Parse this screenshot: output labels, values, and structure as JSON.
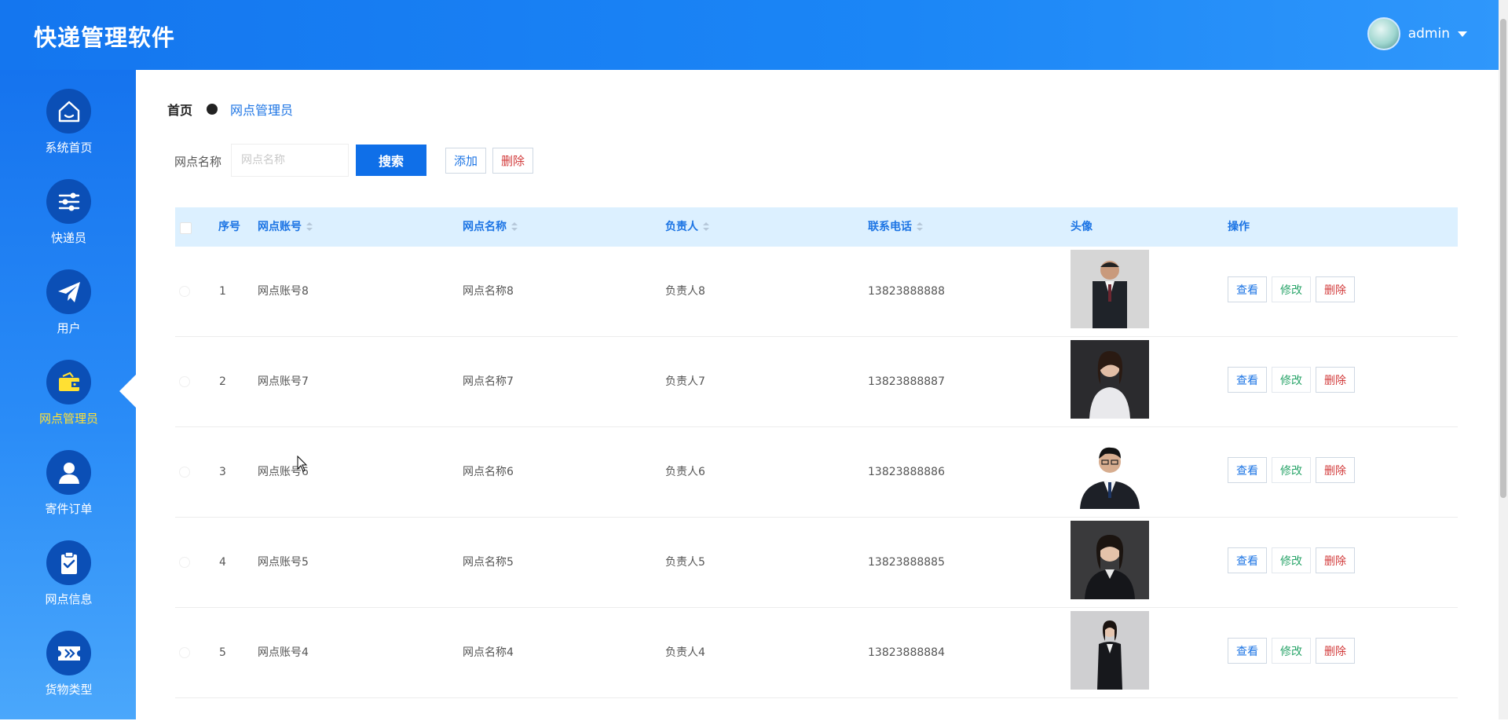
{
  "app": {
    "title": "快递管理软件"
  },
  "user": {
    "name": "admin"
  },
  "sidebar": {
    "items": [
      {
        "label": "系统首页",
        "icon": "home-icon"
      },
      {
        "label": "快递员",
        "icon": "sliders-icon"
      },
      {
        "label": "用户",
        "icon": "paper-plane-icon"
      },
      {
        "label": "网点管理员",
        "icon": "wallet-icon",
        "active": true
      },
      {
        "label": "寄件订单",
        "icon": "user-icon"
      },
      {
        "label": "网点信息",
        "icon": "clipboard-check-icon"
      },
      {
        "label": "货物类型",
        "icon": "ticket-icon"
      }
    ]
  },
  "breadcrumb": {
    "home": "首页",
    "current": "网点管理员"
  },
  "filter": {
    "label": "网点名称",
    "placeholder": "网点名称",
    "value": "",
    "search_label": "搜索",
    "add_label": "添加",
    "delete_label": "删除"
  },
  "table": {
    "headers": {
      "index": "序号",
      "account": "网点账号",
      "name": "网点名称",
      "manager": "负责人",
      "phone": "联系电话",
      "avatar": "头像",
      "actions": "操作"
    },
    "actions": {
      "view": "查看",
      "edit": "修改",
      "delete": "删除"
    },
    "rows": [
      {
        "index": "1",
        "account": "网点账号8",
        "name": "网点名称8",
        "manager": "负责人8",
        "phone": "13823888888",
        "photo": "man-suit-full"
      },
      {
        "index": "2",
        "account": "网点账号7",
        "name": "网点名称7",
        "manager": "负责人7",
        "phone": "13823888887",
        "photo": "woman-white-shirt"
      },
      {
        "index": "3",
        "account": "网点账号6",
        "name": "网点名称6",
        "manager": "负责人6",
        "phone": "13823888886",
        "photo": "man-suit-glasses"
      },
      {
        "index": "4",
        "account": "网点账号5",
        "name": "网点名称5",
        "manager": "负责人5",
        "phone": "13823888885",
        "photo": "woman-black-suit"
      },
      {
        "index": "5",
        "account": "网点账号4",
        "name": "网点名称4",
        "manager": "负责人4",
        "phone": "13823888884",
        "photo": "woman-standing-suit"
      }
    ]
  },
  "colors": {
    "primary": "#0f6fe8",
    "header_bg": "#dcf0ff",
    "active_nav": "#ffe033",
    "danger": "#d23a3a",
    "success": "#2aa56a"
  }
}
